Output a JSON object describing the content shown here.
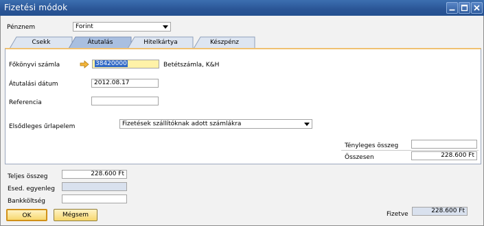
{
  "window": {
    "title": "Fizetési módok",
    "buttons": [
      "minimize-icon",
      "maximize-icon",
      "close-icon"
    ]
  },
  "currency": {
    "label": "Pénznem",
    "value": "Forint"
  },
  "tabs": [
    {
      "label": "Csekk",
      "active": false
    },
    {
      "label": "Átutalás",
      "active": true
    },
    {
      "label": "Hitelkártya",
      "active": false
    },
    {
      "label": "Készpénz",
      "active": false
    }
  ],
  "transfer": {
    "gl_account_label": "Főkönyvi számla",
    "gl_account_value": "38420000",
    "gl_account_name": "Betétszámla, K&H",
    "transfer_date_label": "Átutalási dátum",
    "transfer_date_value": "2012.08.17",
    "reference_label": "Referencia",
    "reference_value": "",
    "primary_form_label": "Elsődleges űrlapelem",
    "primary_form_value": "Fizetések szállítóknak adott számlákra",
    "actual_amount_label": "Tényleges összeg",
    "actual_amount_value": "",
    "total_label": "Összesen",
    "total_value": "228.600 Ft"
  },
  "footer": {
    "total_amount_label": "Teljes összeg",
    "total_amount_value": "228.600 Ft",
    "balance_due_label": "Esed. egyenleg",
    "balance_due_value": "",
    "bank_charge_label": "Bankköltség",
    "bank_charge_value": "",
    "paid_label": "Fizetve",
    "paid_value": "228.600 Ft"
  },
  "actions": {
    "ok_label": "OK",
    "cancel_label": "Mégsem"
  },
  "colors": {
    "titlebar": "#2a5596",
    "active_tab_accent": "#f0c070",
    "highlight_field": "#fff2a8",
    "selected_text_bg": "#3169c6",
    "button_gold": "#f7d76e"
  }
}
